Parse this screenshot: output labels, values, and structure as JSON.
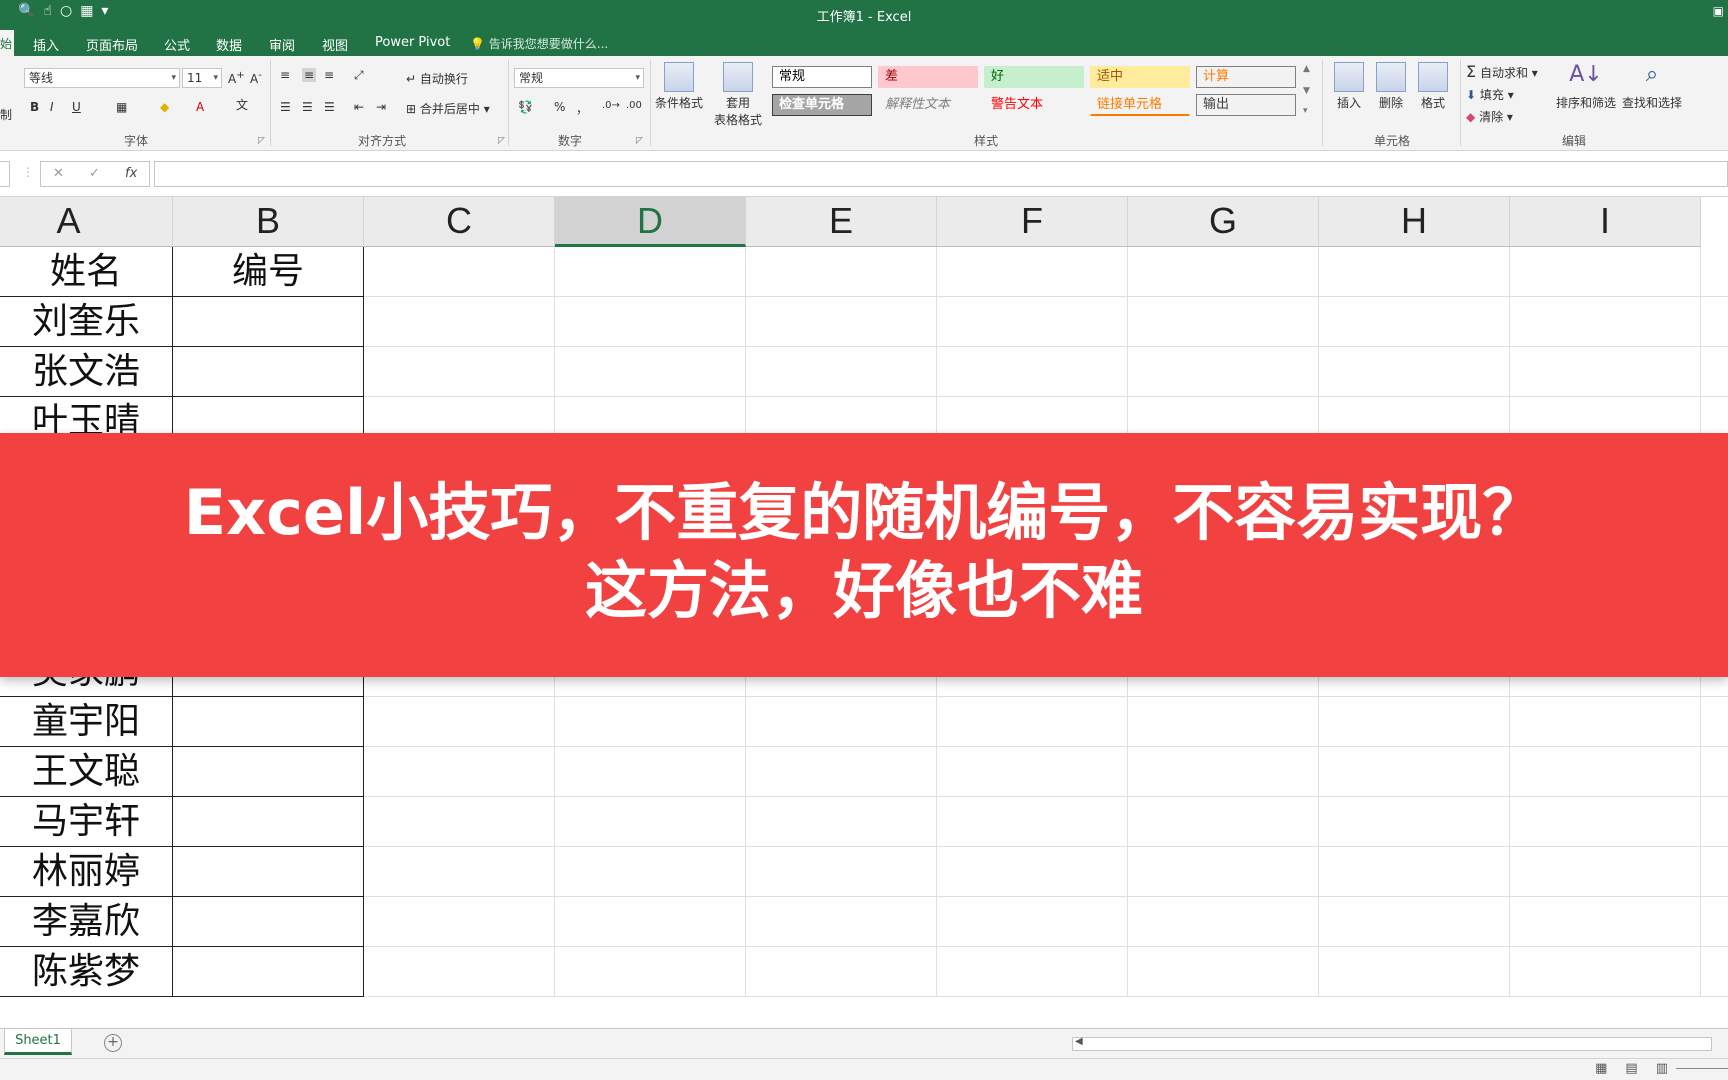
{
  "window": {
    "title": "工作簿1 - Excel"
  },
  "tabs": [
    "插入",
    "页面布局",
    "公式",
    "数据",
    "审阅",
    "视图",
    "Power Pivot"
  ],
  "active_tab_stub": "始",
  "tell_me": "告诉我您想要做什么...",
  "ribbon": {
    "font": {
      "name": "等线",
      "size": "11",
      "group_label": "字体"
    },
    "align": {
      "wrap": "自动换行",
      "merge": "合并后居中",
      "group_label": "对齐方式"
    },
    "number": {
      "format": "常规",
      "percent": "%",
      "comma": "，",
      "group_label": "数字"
    },
    "styles": {
      "conditional": "条件格式",
      "table_line1": "套用",
      "table_line2": "表格格式",
      "cells": [
        {
          "label": "常规",
          "bg": "#ffffff",
          "fg": "#000000"
        },
        {
          "label": "差",
          "bg": "#ffc7ce",
          "fg": "#9c0006"
        },
        {
          "label": "好",
          "bg": "#c6efce",
          "fg": "#006100"
        },
        {
          "label": "适中",
          "bg": "#ffeb9c",
          "fg": "#9c5700"
        },
        {
          "label": "计算",
          "bg": "#f2f2f2",
          "fg": "#fa7d00"
        },
        {
          "label": "检查单元格",
          "bg": "#a5a5a5",
          "fg": "#ffffff"
        },
        {
          "label": "解释性文本",
          "bg": "#f3f3f3",
          "fg": "#7f7f7f"
        },
        {
          "label": "警告文本",
          "bg": "#f3f3f3",
          "fg": "#ff0000"
        },
        {
          "label": "链接单元格",
          "bg": "#f3f3f3",
          "fg": "#fa7d00"
        },
        {
          "label": "输出",
          "bg": "#f2f2f2",
          "fg": "#3f3f3f"
        }
      ],
      "group_label": "样式"
    },
    "cells": {
      "insert": "插入",
      "delete": "删除",
      "format": "格式",
      "group_label": "单元格"
    },
    "editing": {
      "autosum": "自动求和",
      "fill": "填充",
      "clear": "清除",
      "sort": "排序和筛选",
      "find": "查找和选择",
      "group_label": "编辑"
    },
    "clipboard_stub": "制"
  },
  "formula_bar": {
    "cancel": "✕",
    "enter": "✓",
    "fx": "fx"
  },
  "columns": [
    "A",
    "B",
    "C",
    "D",
    "E",
    "F",
    "G",
    "H",
    "I"
  ],
  "selected_column": "D",
  "rows": [
    [
      "姓名",
      "编号"
    ],
    [
      "刘奎乐",
      ""
    ],
    [
      "张文浩",
      ""
    ],
    [
      "叶玉晴",
      ""
    ],
    [
      "",
      ""
    ],
    [
      "",
      ""
    ],
    [
      "",
      ""
    ],
    [
      "",
      ""
    ],
    [
      "吴家鹏",
      ""
    ],
    [
      "童宇阳",
      ""
    ],
    [
      "王文聪",
      ""
    ],
    [
      "马宇轩",
      ""
    ],
    [
      "林丽婷",
      ""
    ],
    [
      "李嘉欣",
      ""
    ],
    [
      "陈紫梦",
      ""
    ]
  ],
  "banner": {
    "line1": "Excel小技巧，不重复的随机编号，不容易实现？",
    "line2": "这方法，好像也不难"
  },
  "sheet": {
    "name": "Sheet1",
    "add": "+"
  }
}
